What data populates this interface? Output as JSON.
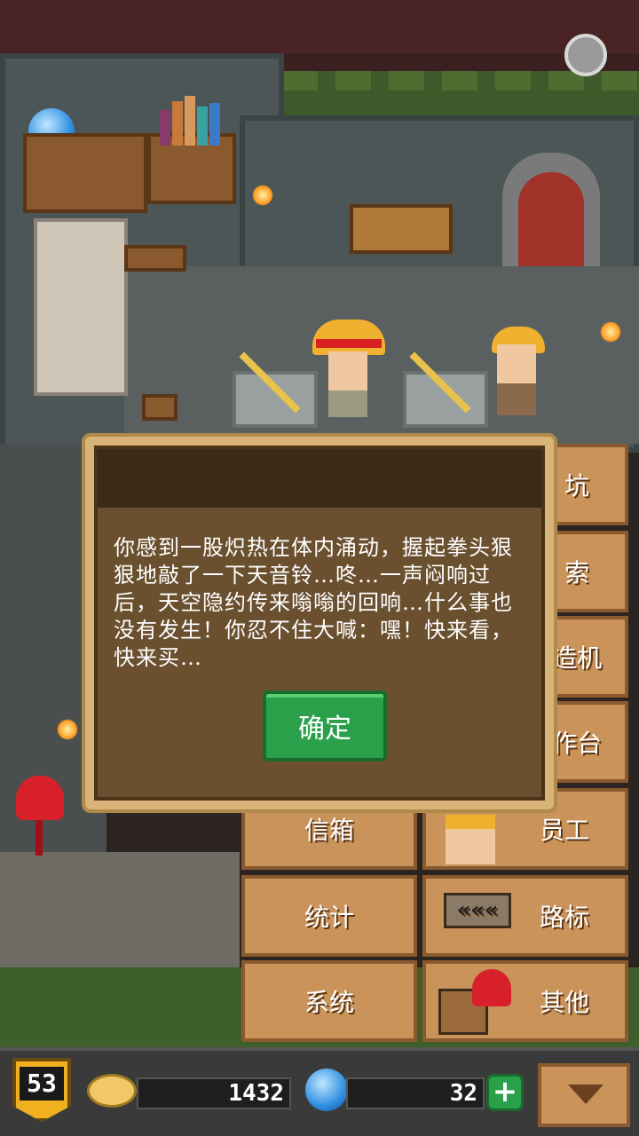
{
  "dialog": {
    "message": "你感到一股炽热在体内涌动，握起拳头狠狠地敲了一下天音铃…咚…一声闷响过后，天空隐约传来嗡嗡的回响…什么事也没有发生！你忍不住大喊：嘿！快来看，快来买…",
    "confirm_label": "确定"
  },
  "side_menu": {
    "partial_items": [
      "坑",
      "索",
      "造机",
      "作台"
    ],
    "items": [
      {
        "label": "信箱"
      },
      {
        "label": "员工"
      },
      {
        "label": "统计"
      },
      {
        "label": "路标"
      },
      {
        "label": "系统"
      },
      {
        "label": "其他"
      }
    ]
  },
  "status_bar": {
    "level": "53",
    "coins": "1432",
    "gems": "32",
    "add_label": "+"
  },
  "icons": {
    "settings": "gear-icon",
    "coin": "coin-icon",
    "gem": "gem-icon",
    "add": "plus-icon",
    "dropdown": "chevron-down-icon"
  },
  "colors": {
    "wood": "#c9935a",
    "dialog_bg": "#6b5030",
    "confirm_green": "#2aa04a",
    "level_gold": "#f0b020"
  }
}
